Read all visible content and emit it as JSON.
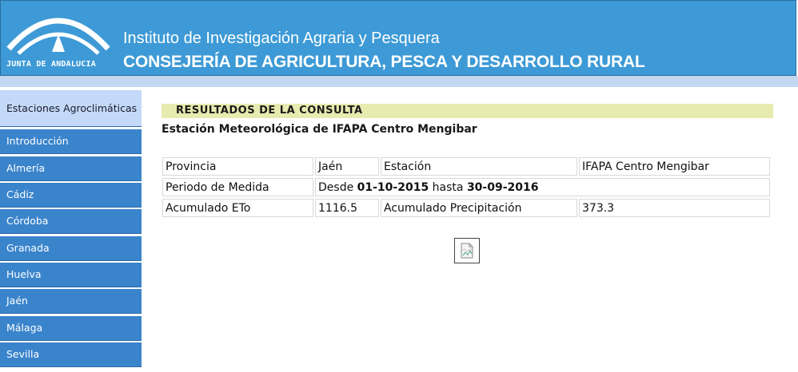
{
  "header": {
    "logo_text": "JUNTA DE ANDALUCIA",
    "institute": "Instituto de Investigación Agraria y Pesquera",
    "consejeria": "CONSEJERÍA DE AGRICULTURA, PESCA Y DESARROLLO RURAL",
    "colors": {
      "banner": "#3d9ad6",
      "divider": "#c3d7f0"
    }
  },
  "sidebar": {
    "items": [
      {
        "label": "Estaciones Agroclimáticas",
        "active": true
      },
      {
        "label": "Introducción"
      },
      {
        "label": "Almería"
      },
      {
        "label": "Cádiz"
      },
      {
        "label": "Córdoba"
      },
      {
        "label": "Granada"
      },
      {
        "label": "Huelva"
      },
      {
        "label": "Jaén"
      },
      {
        "label": "Málaga"
      },
      {
        "label": "Sevilla"
      }
    ],
    "colors": {
      "item": "#3a84cc",
      "active": "#c3d9f7"
    }
  },
  "main": {
    "results_heading": "RESULTADOS DE LA CONSULTA",
    "station_title": "Estación Meteorológica de IFAPA Centro Mengibar",
    "table": {
      "provincia_label": "Provincia",
      "provincia_value": "Jaén",
      "estacion_label": "Estación",
      "estacion_value": "IFAPA Centro Mengibar",
      "periodo_label": "Periodo de Medida",
      "periodo_desde": "Desde",
      "periodo_start": "01-10-2015",
      "periodo_hasta": "hasta",
      "periodo_end": "30-09-2016",
      "eto_label": "Acumulado ETo",
      "eto_value": "1116.5",
      "precip_label": "Acumulado Precipitación",
      "precip_value": "373.3"
    },
    "chart_icon": "chart-image-icon"
  }
}
